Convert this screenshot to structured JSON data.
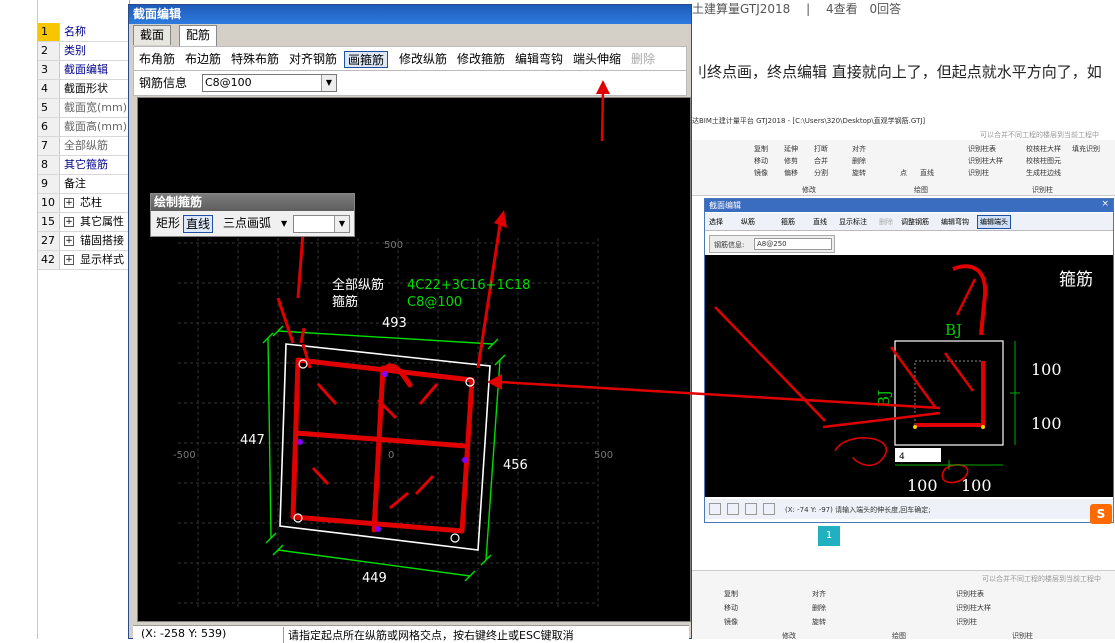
{
  "left_props": {
    "rows": [
      {
        "num": "1",
        "name": "名称",
        "style": "blue",
        "selected": true
      },
      {
        "num": "2",
        "name": "类别",
        "style": "blue"
      },
      {
        "num": "3",
        "name": "截面编辑",
        "style": "blue"
      },
      {
        "num": "4",
        "name": "截面形状",
        "style": ""
      },
      {
        "num": "5",
        "name": "截面宽(mm)",
        "style": "gray"
      },
      {
        "num": "6",
        "name": "截面高(mm)",
        "style": "gray"
      },
      {
        "num": "7",
        "name": "全部纵筋",
        "style": "gray"
      },
      {
        "num": "8",
        "name": "其它箍筋",
        "style": "blue"
      },
      {
        "num": "9",
        "name": "备注",
        "style": ""
      },
      {
        "num": "10",
        "name": "芯柱",
        "style": "",
        "plus": true
      },
      {
        "num": "15",
        "name": "其它属性",
        "style": "",
        "plus": true
      },
      {
        "num": "27",
        "name": "锚固搭接",
        "style": "",
        "plus": true
      },
      {
        "num": "42",
        "name": "显示样式",
        "style": "",
        "plus": true
      }
    ]
  },
  "dialog": {
    "title": "截面编辑",
    "tabs": [
      "截面",
      "配筋"
    ],
    "active_tab": "配筋",
    "toolbar": {
      "buttons": [
        "布角筋",
        "布边筋",
        "特殊布筋",
        "对齐钢筋",
        "画箍筋",
        "修改纵筋",
        "修改箍筋",
        "编辑弯钩",
        "端头伸缩",
        "删除"
      ],
      "active": "画箍筋",
      "disabled": "删除"
    },
    "rebar_info_label": "钢筋信息",
    "rebar_info_value": "C8@100",
    "draw_panel": {
      "title": "绘制箍筋",
      "items": [
        "矩形",
        "直线",
        "三点画弧"
      ],
      "active": "直线"
    },
    "canvas": {
      "label_all_rebar": "全部纵筋",
      "label_stirrup": "箍筋",
      "value_all_rebar": "4C22+3C16+1C18",
      "value_stirrup": "C8@100",
      "axis_500_top": "500",
      "axis_neg500": "-500",
      "axis_0": "0",
      "axis_500_right": "500",
      "dim_top": "493",
      "dim_left": "447",
      "dim_right": "456",
      "dim_bottom": "449"
    },
    "status": {
      "coords": "(X: -258 Y: 539)",
      "message": "请指定起点所在纵筋或网格交点，按右键终止或ESC键取消"
    }
  },
  "web": {
    "top_text": "土建算量GTJ2018",
    "separator": "|",
    "views": "4查看",
    "answers": "0回答",
    "question_text": "刂终点画，终点编辑 直接就向上了，但起点就水平方向了，如"
  },
  "screenshot": {
    "app_path": "达BIM土建计量平台 GTJ2018 - [C:\\Users\\320\\Desktop\\直观学钢筋.GTJ]",
    "ribbon_items": [
      "复制",
      "移动",
      "镜像",
      "延伸",
      "修剪",
      "偏移",
      "打断",
      "合并",
      "分割",
      "对齐",
      "删除",
      "旋转",
      "点",
      "直线",
      "识别柱表",
      "识别柱大样",
      "识别柱",
      "校核柱大样",
      "校核柱图元",
      "生成柱边线",
      "填充识别"
    ],
    "ribbon_groups": [
      "修改",
      "绘图",
      "识别柱"
    ],
    "hint_top": "可以合并不同工程的楼层到当前工程中",
    "dialog_title": "截面编辑",
    "toolbar_items": [
      "选择",
      "纵筋",
      "箍筋",
      "直线",
      "显示标注",
      "删除",
      "调整钢筋",
      "编辑弯钩",
      "编辑端头"
    ],
    "active_toolbar": "编辑端头",
    "rebar_label": "钢筋信息:",
    "rebar_value": "A8@250",
    "canvas_labels": {
      "bj_top": "BJ",
      "bj_side": "BJ",
      "stirrup": "箍筋",
      "dim1": "100",
      "dim2": "100",
      "dim3": "100",
      "dim4": "100",
      "input": "4"
    },
    "status": "(X: -74 Y: -97)  请输入端头的伸长度,回车确定;",
    "badge": "1"
  },
  "colors": {
    "red": "#ff0000",
    "green": "#00cc00",
    "rebar_red": "#e00000"
  }
}
